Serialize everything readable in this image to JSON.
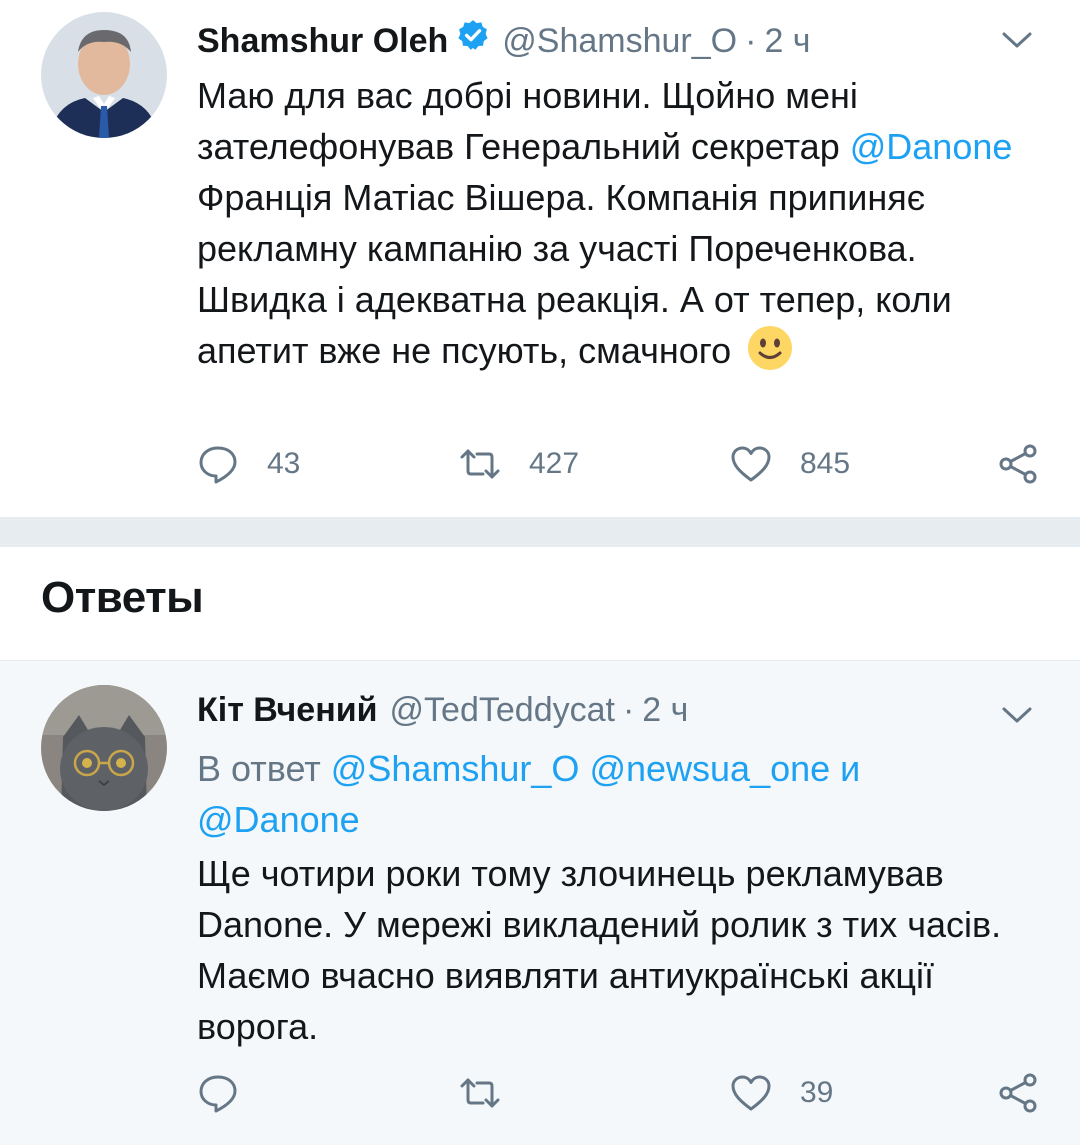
{
  "main_tweet": {
    "name": "Shamshur Oleh",
    "handle": "@Shamshur_O",
    "separator": "·",
    "time": "2 ч",
    "text_part1": "Маю для вас добрі новини. Щойно мені зателефонував Генеральний секретар ",
    "mention": "@Danone",
    "text_part2": " Франція Матіас Вішера. Компанія припиняє рекламну кампанію за участі Пореченкова. Швидка і адекватна реакція. А от тепер, коли апетит вже не псують, смачного",
    "emoji": "slightly-smiling-face-emoji",
    "counts": {
      "replies": "43",
      "retweets": "427",
      "likes": "845"
    }
  },
  "replies_header": {
    "title": "Ответы"
  },
  "reply_tweet": {
    "name": "Кіт Вчений",
    "handle": "@TedTeddycat",
    "separator": "·",
    "time": "2 ч",
    "reply_prefix": "В ответ ",
    "reply_mention1": "@Shamshur_O",
    "reply_mention2": "@newsua_one",
    "reply_and": " и ",
    "reply_mention3": "@Danone",
    "text": "Ще чотири роки тому злочинець рекламував Danone. У мережі викладений ролик з тих часів. Маємо вчасно виявляти антиукраїнські акції ворога.",
    "counts": {
      "replies": "",
      "retweets": "",
      "likes": "39"
    }
  },
  "colors": {
    "link": "#1da1f2",
    "muted": "#657786",
    "divider": "#e6ecf0",
    "reply_bg": "#f5f8fa"
  }
}
